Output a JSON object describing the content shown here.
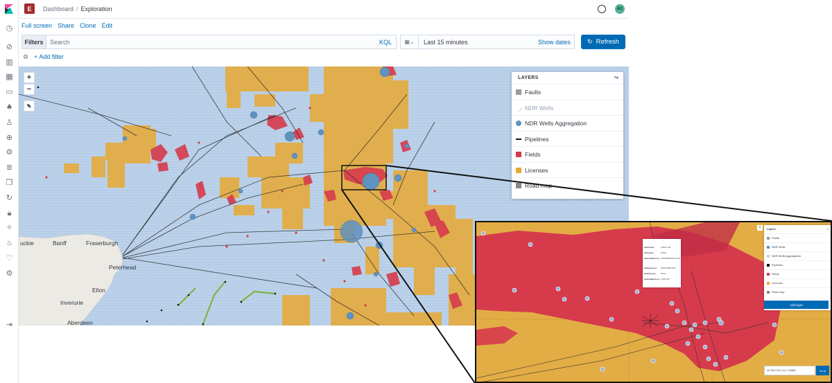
{
  "header": {
    "space_initial": "E",
    "breadcrumb": [
      "Dashboard",
      "Exploration"
    ],
    "avatar_initials": "AC"
  },
  "actions": [
    "Full screen",
    "Share",
    "Clone",
    "Edit"
  ],
  "query": {
    "filters_label": "Filters",
    "search_placeholder": "Search",
    "language": "KQL",
    "time_range": "Last 15 minutes",
    "show_dates": "Show dates",
    "refresh": "Refresh",
    "add_filter": "+ Add filter"
  },
  "map": {
    "zoom_in": "+",
    "zoom_out": "−",
    "places": [
      "Fraserburgh",
      "Banff",
      "uckie",
      "Peterhead",
      "Ellon",
      "Inverurie",
      "Aberdeen"
    ]
  },
  "layers": {
    "title": "LAYERS",
    "items": [
      {
        "label": "Faults",
        "color": "#9a9a9a",
        "muted": false
      },
      {
        "label": "NDR Wells",
        "color": "#c8ccd2",
        "muted": true
      },
      {
        "label": "NDR Wells Aggregation",
        "color": "#6092c0",
        "muted": false
      },
      {
        "label": "Pipelines",
        "color": "#111111",
        "muted": false
      },
      {
        "label": "Fields",
        "color": "#d63b4c",
        "muted": false
      },
      {
        "label": "Licenses",
        "color": "#e7a837",
        "muted": false
      },
      {
        "label": "Road map",
        "color": "#8a8a8a",
        "muted": false
      }
    ]
  },
  "inset": {
    "layers_title": "Layers",
    "items": [
      {
        "label": "Faults",
        "color": "#9a9a9a"
      },
      {
        "label": "NDR Wells",
        "color": "#6092c0"
      },
      {
        "label": "NDR Wells Aggregation",
        "color": "#c8ccd2"
      },
      {
        "label": "Pipelines",
        "color": "#111111"
      },
      {
        "label": "Fields",
        "color": "#d63b4c"
      },
      {
        "label": "Licenses",
        "color": "#e7a837"
      },
      {
        "label": "Road map",
        "color": "#8a8a8a"
      }
    ],
    "add_layer": "Add layer",
    "tooltip": [
      {
        "k": "well.name",
        "v": "7/9/16 -2E"
      },
      {
        "k": "well.state",
        "v": "SUSA"
      },
      {
        "k": "well.wellbore.ty",
        "v": "CONDENSATE GAS"
      },
      {
        "k": "well.purpose",
        "v": "EXPLORATION"
      },
      {
        "k": "well.license",
        "v": "P172"
      },
      {
        "k": "well.wellbore.ty",
        "v": "LAST-SIT"
      }
    ],
    "coords": "lat: 58.47191, lon: 1.00895",
    "goto": "Go to"
  },
  "colors": {
    "brand_blue": "#006bb4",
    "license": "#e7a837",
    "field": "#d63b4c",
    "sea": "#bcd2ea",
    "well": "#6092c0"
  }
}
